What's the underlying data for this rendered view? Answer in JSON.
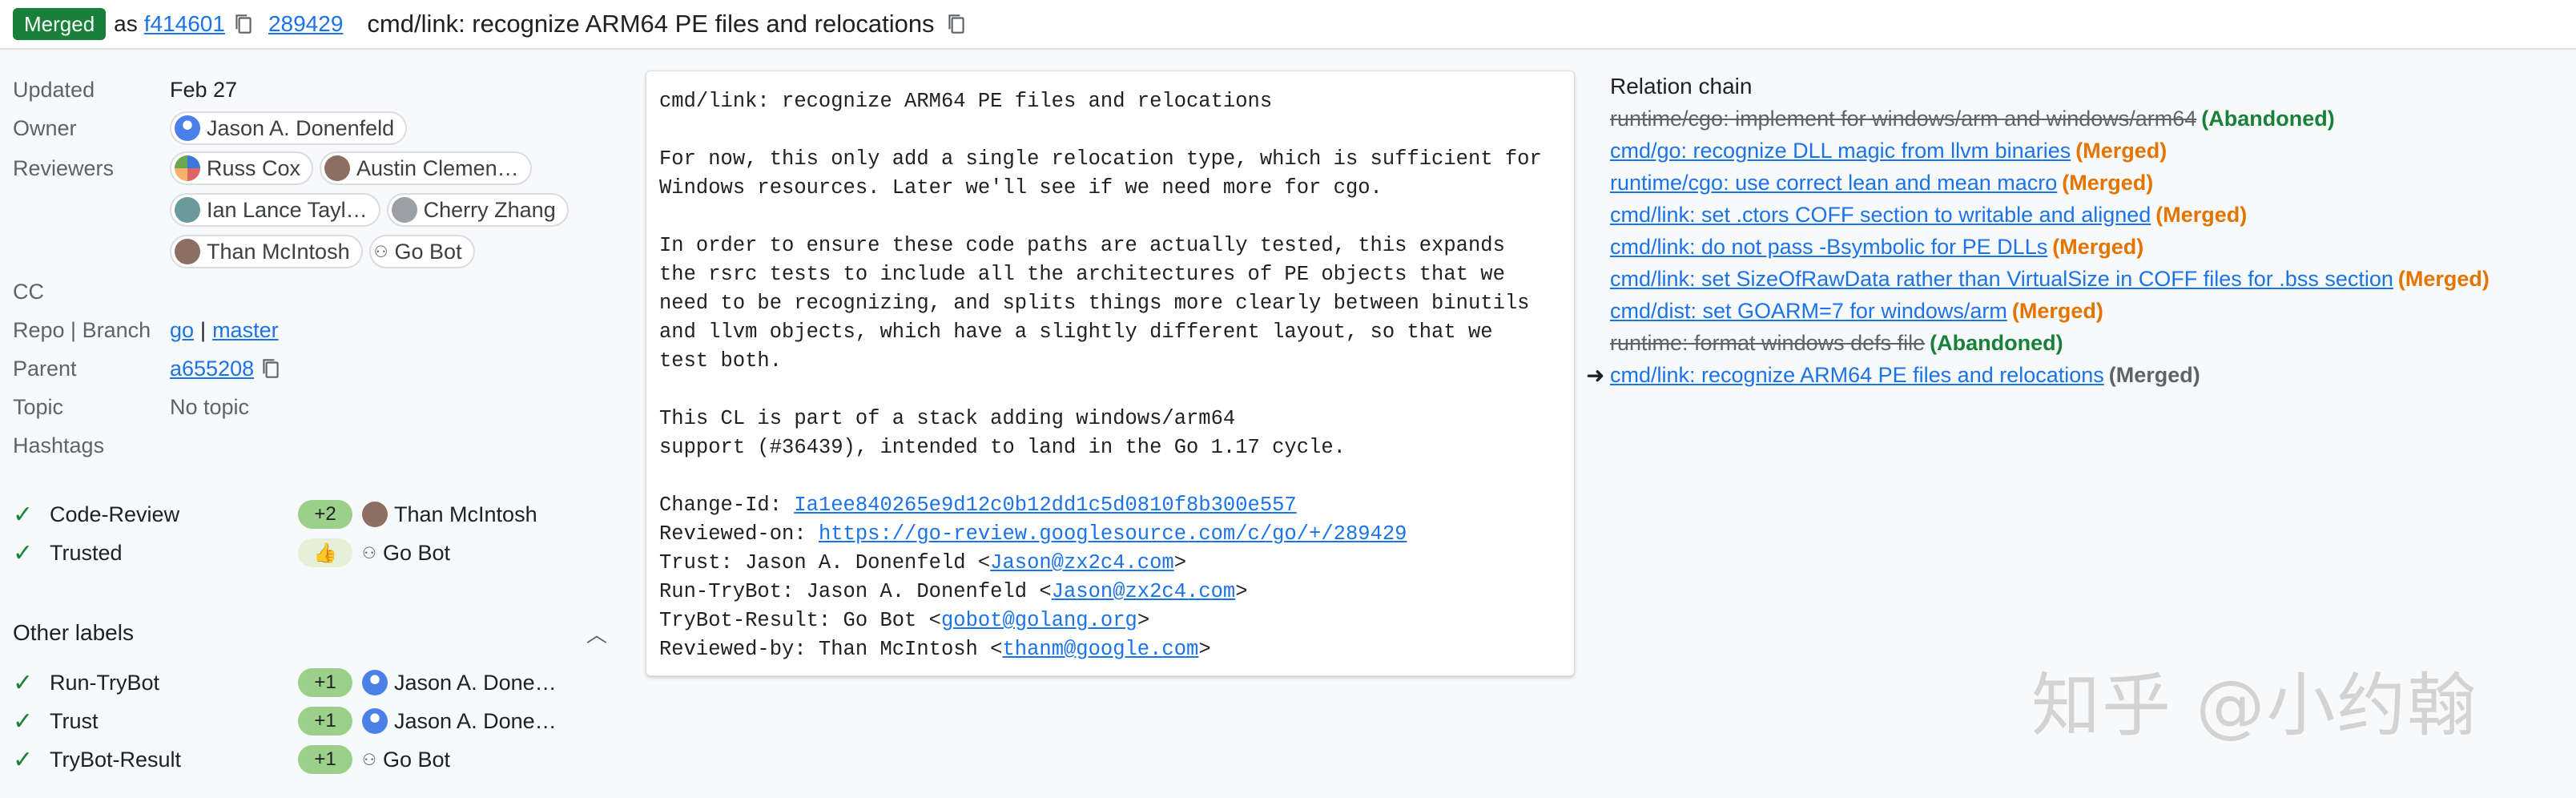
{
  "header": {
    "status": "Merged",
    "as_text": "as",
    "commit_short": "f414601",
    "change_number": "289429",
    "subject": "cmd/link: recognize ARM64 PE files and relocations"
  },
  "meta": {
    "updated_label": "Updated",
    "updated_value": "Feb 27",
    "owner_label": "Owner",
    "owner": "Jason A. Donenfeld",
    "reviewers_label": "Reviewers",
    "reviewers": [
      "Russ Cox",
      "Austin Clemen…",
      "Ian Lance Tayl…",
      "Cherry Zhang",
      "Than McIntosh",
      "Go Bot"
    ],
    "cc_label": "CC",
    "repo_label": "Repo | Branch",
    "repo": "go",
    "separator": "|",
    "branch": "master",
    "parent_label": "Parent",
    "parent": "a655208",
    "topic_label": "Topic",
    "topic_value": "No topic",
    "hashtags_label": "Hashtags"
  },
  "labels": [
    {
      "name": "Code-Review",
      "vote": "+2",
      "voter": "Than McIntosh"
    },
    {
      "name": "Trusted",
      "vote": "👍",
      "voter": "Go Bot"
    }
  ],
  "other_labels_title": "Other labels",
  "other_labels": [
    {
      "name": "Run-TryBot",
      "vote": "+1",
      "voter": "Jason A. Done…"
    },
    {
      "name": "Trust",
      "vote": "+1",
      "voter": "Jason A. Done…"
    },
    {
      "name": "TryBot-Result",
      "vote": "+1",
      "voter": "Go Bot"
    }
  ],
  "commit": {
    "l1": "cmd/link: recognize ARM64 PE files and relocations",
    "l2": "For now, this only add a single relocation type, which is sufficient for",
    "l3": "Windows resources. Later we'll see if we need more for cgo.",
    "l4": "In order to ensure these code paths are actually tested, this expands",
    "l5": "the rsrc tests to include all the architectures of PE objects that we",
    "l6": "need to be recognizing, and splits things more clearly between binutils",
    "l7": "and llvm objects, which have a slightly different layout, so that we",
    "l8": "test both.",
    "l9": "This CL is part of a stack adding windows/arm64",
    "l10": "support (#36439), intended to land in the Go 1.17 cycle.",
    "change_id_label": "Change-Id: ",
    "change_id": "Ia1ee840265e9d12c0b12dd1c5d0810f8b300e557",
    "reviewed_on_label": "Reviewed-on: ",
    "reviewed_on": "https://go-review.googlesource.com/c/go/+/289429",
    "trust_label": "Trust: Jason A. Donenfeld <",
    "trust_email": "Jason@zx2c4.com",
    "run_trybot_label": "Run-TryBot: Jason A. Donenfeld <",
    "run_trybot_email": "Jason@zx2c4.com",
    "trybot_result_label": "TryBot-Result: Go Bot <",
    "trybot_result_email": "gobot@golang.org",
    "reviewed_by_label": "Reviewed-by: Than McIntosh <",
    "reviewed_by_email": "thanm@google.com",
    "close_angle": ">"
  },
  "relation": {
    "title": "Relation chain",
    "arrow": "➜",
    "items": [
      {
        "text": "runtime/cgo: implement for windows/arm and windows/arm64",
        "status": "(Abandoned)"
      },
      {
        "text": "cmd/go: recognize DLL magic from llvm binaries",
        "status": "(Merged)"
      },
      {
        "text": "runtime/cgo: use correct lean and mean macro",
        "status": "(Merged)"
      },
      {
        "text": "cmd/link: set .ctors COFF section to writable and aligned",
        "status": "(Merged)"
      },
      {
        "text": "cmd/link: do not pass -Bsymbolic for PE DLLs",
        "status": "(Merged)"
      },
      {
        "text": "cmd/link: set SizeOfRawData rather than VirtualSize in COFF files for .bss section",
        "status": "(Merged)"
      },
      {
        "text": "cmd/dist: set GOARM=7 for windows/arm",
        "status": "(Merged)"
      },
      {
        "text": "runtime: format windows defs file",
        "status": "(Abandoned)"
      },
      {
        "text": "cmd/link: recognize ARM64 PE files and relocations",
        "status": "(Merged)"
      }
    ]
  },
  "watermark": "知乎 @小约翰"
}
